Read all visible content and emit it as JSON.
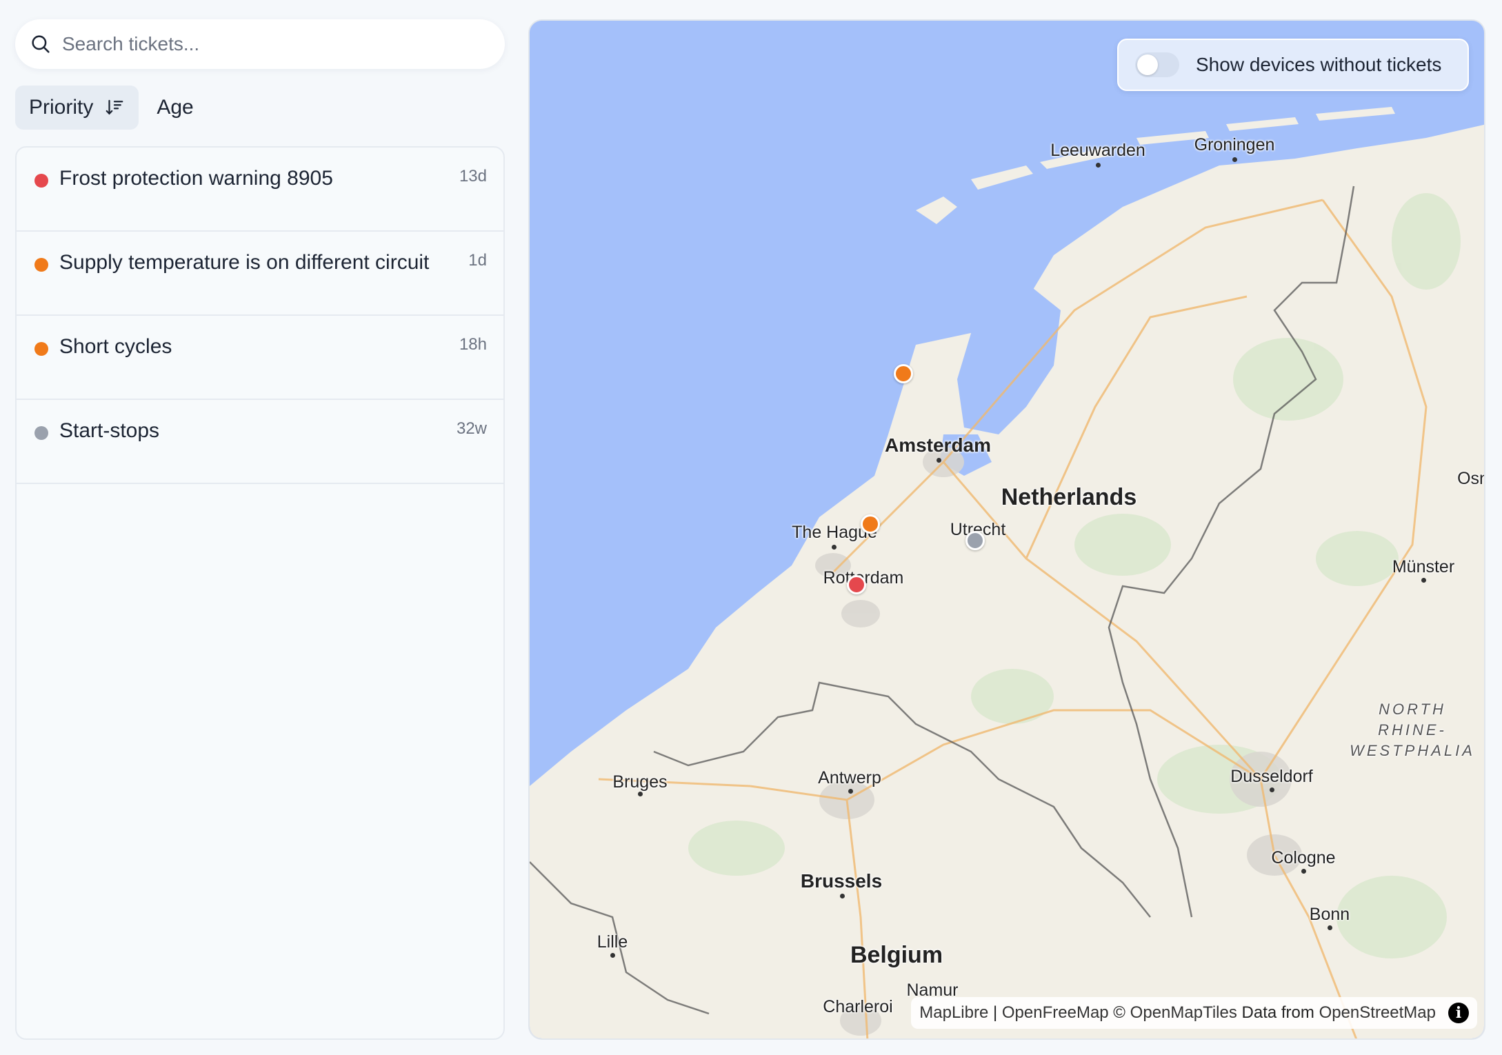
{
  "search": {
    "placeholder": "Search tickets..."
  },
  "sort": {
    "priority_label": "Priority",
    "age_label": "Age",
    "active": "priority"
  },
  "tickets": [
    {
      "title": "Frost protection warning 8905",
      "age": "13d",
      "color": "#e5484d"
    },
    {
      "title": "Supply temperature is on different circuit",
      "age": "1d",
      "color": "#f07a1a"
    },
    {
      "title": "Short cycles",
      "age": "18h",
      "color": "#f07a1a"
    },
    {
      "title": "Start-stops",
      "age": "32w",
      "color": "#9aa1ad"
    }
  ],
  "map": {
    "toggle_label": "Show devices without tickets",
    "toggle_on": false,
    "attribution": {
      "maplibre": "MapLibre",
      "sep": " | ",
      "openfreemap": "OpenFreeMap",
      "copy": " © ",
      "openmaptiles": "OpenMapTiles",
      "data_from": " Data from ",
      "osm": "OpenStreetMap"
    },
    "labels": {
      "leeuwarden": "Leeuwarden",
      "groningen": "Groningen",
      "amsterdam": "Amsterdam",
      "netherlands": "Netherlands",
      "the_hague": "The Hague",
      "utrecht": "Utrecht",
      "rotterdam": "Rotterdam",
      "munster": "Münster",
      "osn": "Osn",
      "nrw": "NORTH RHINE-\nWESTPHALIA",
      "bruges": "Bruges",
      "antwerp": "Antwerp",
      "dusseldorf": "Dusseldorf",
      "cologne": "Cologne",
      "brussels": "Brussels",
      "bonn": "Bonn",
      "lille": "Lille",
      "belgium": "Belgium",
      "namur": "Namur",
      "charleroi": "Charleroi"
    },
    "colors": {
      "water": "#a4c0fa",
      "land": "#f2efe6",
      "orange_marker": "#f07a1a",
      "red_marker": "#e5484d",
      "grey_marker": "#9aa1ad"
    }
  }
}
